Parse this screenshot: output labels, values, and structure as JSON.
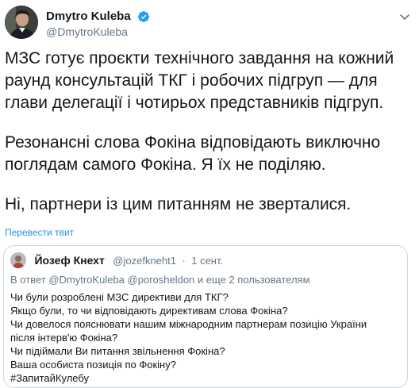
{
  "author": {
    "display_name": "Dmytro Kuleba",
    "handle": "@DmytroKuleba",
    "verified": true,
    "avatar_icon": "profile-photo"
  },
  "tweet": {
    "paragraphs": [
      "МЗС готує проєкти технічного завдання на кожний раунд консультацій ТКГ і робочих підгруп — для глави делегації і чотирьох представників підгруп.",
      "Резонансні слова Фокіна відповідають виключно поглядам самого Фокіна. Я їх не поділяю.",
      "Ні, партнери із цим питанням не зверталися."
    ],
    "translate_label": "Перевести твит"
  },
  "quote": {
    "display_name": "Йозеф Кнехт",
    "handle": "@jozefkneht1",
    "separator": "·",
    "date": "1 сент.",
    "reply_prefix": "В ответ",
    "reply_mention_1": "@DmytroKuleba",
    "reply_mention_2": "@porosheldon",
    "reply_suffix": "и еще 2 пользователям",
    "lines": [
      "Чи були розроблені МЗС директиви для ТКГ?",
      "Якщо були, то чи відповідають директивам слова Фокіна?",
      "Чи довелося пояснювати нашим міжнародним партнерам позицію України",
      "після інтерв'ю Фокіна?",
      "Чи підіймали Ви питання звільнення Фокіна?",
      "Ваша особиста позиція по Фокіну?",
      "#ЗапитайКулебу"
    ]
  },
  "colors": {
    "text": "#14171a",
    "secondary": "#657786",
    "link": "#1b95e0",
    "border": "#ccd6dd",
    "verified": "#1da1f2"
  }
}
